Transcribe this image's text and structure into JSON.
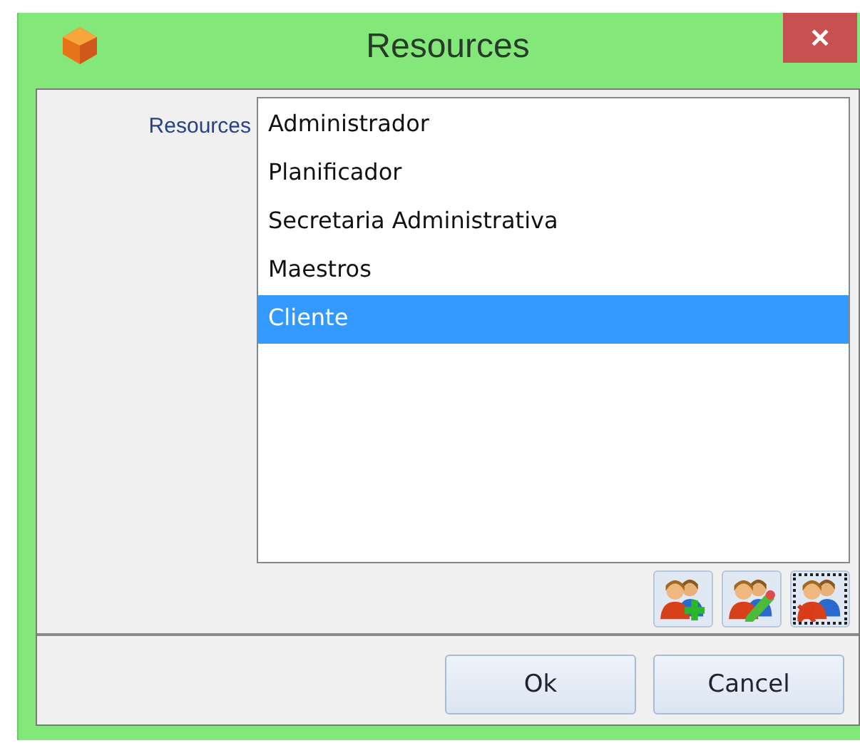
{
  "window": {
    "title": "Resources",
    "close": "✕"
  },
  "field": {
    "label": "Resources"
  },
  "items": [
    {
      "text": "Administrador",
      "selected": false
    },
    {
      "text": "Planificador",
      "selected": false
    },
    {
      "text": "Secretaria Administrativa",
      "selected": false
    },
    {
      "text": "Maestros",
      "selected": false
    },
    {
      "text": "Cliente",
      "selected": true
    }
  ],
  "tools": [
    {
      "kind": "add",
      "focused": false
    },
    {
      "kind": "edit",
      "focused": false
    },
    {
      "kind": "delete",
      "focused": true
    }
  ],
  "buttons": [
    "Ok",
    "Cancel"
  ]
}
